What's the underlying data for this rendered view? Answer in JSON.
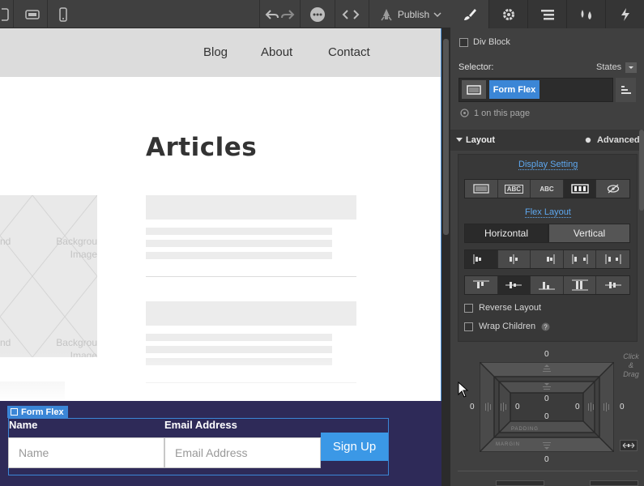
{
  "toolbar": {
    "publish_label": "Publish",
    "icons": [
      "tablet-icon",
      "tablet-landscape-icon",
      "mobile-icon",
      "undo-icon",
      "redo-icon",
      "comments-icon",
      "code-icon",
      "publish-rocket-icon",
      "chevron-down-icon"
    ]
  },
  "canvas": {
    "nav_links": [
      "Blog",
      "About",
      "Contact"
    ],
    "articles_title": "Articles",
    "bg_image_text_left": "nd",
    "bg_image_text_right_1": "Backgrou",
    "bg_image_text_right_2": "Image",
    "form_flex_tag": "Form Flex",
    "form": {
      "name_label": "Name",
      "email_label": "Email Address",
      "name_placeholder": "Name",
      "email_placeholder": "Email Address",
      "signup_label": "Sign Up"
    }
  },
  "panel": {
    "tabs": [
      "style-brush-icon",
      "settings-gear-icon",
      "navigator-icon",
      "interactions-drops-icon",
      "lightning-icon"
    ],
    "element_type": "Div Block",
    "selector_label": "Selector:",
    "states_label": "States",
    "selector_class": "Form Flex",
    "on_page": "1 on this page",
    "layout_section": "Layout",
    "advanced_label": "Advanced",
    "display_setting": "Display Setting",
    "display_options": [
      "block",
      "ABC",
      "ABC",
      "flex",
      "none"
    ],
    "flex_layout": "Flex Layout",
    "direction": {
      "horizontal": "Horizontal",
      "vertical": "Vertical",
      "selected": "Horizontal"
    },
    "reverse_layout": "Reverse Layout",
    "wrap_children": "Wrap Children",
    "click_drag_hint": "Click & Drag",
    "box_model": {
      "margin_label": "MARGIN",
      "padding_label": "PADDING",
      "margin_top": "0",
      "margin_right": "0",
      "margin_bottom": "0",
      "margin_left": "0",
      "padding_top": "0",
      "padding_right": "0",
      "padding_bottom": "0",
      "padding_left": "0"
    }
  },
  "colors": {
    "accent": "#3b86d6",
    "panel_bg": "#404040",
    "footer_bg": "#2e2a58",
    "signup_button": "#3b98e6"
  }
}
